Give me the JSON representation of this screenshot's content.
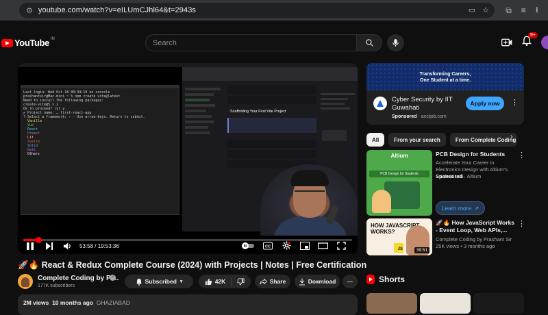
{
  "browser": {
    "url": "youtube.com/watch?v=eILUmCJhl64&t=2943s"
  },
  "header": {
    "logo_text": "YouTube",
    "country": "IN",
    "search_placeholder": "Search",
    "notification_count": "9+"
  },
  "player": {
    "time_current": "53:58",
    "time_total": "19:53:36",
    "time_display": "53:58 / 19:53:36",
    "progress_fraction": 0.045,
    "terminal": {
      "lines": [
        "Last login: Wed Oct 18 00:34:19 on console",
        "prashantsir@Mac-mini ~ % npm create vite@latest",
        "Need to install the following packages:",
        "create-vite@5.x.x",
        "Ok to proceed? (y) y",
        "✔ Project name: … first-react-app",
        "? Select a framework: › - Use arrow-keys. Return to submit."
      ],
      "options": [
        "Vanilla",
        "Vue",
        "React",
        "Preact",
        "Lit",
        "Svelte",
        "Solid",
        "Qwik",
        "Others"
      ]
    },
    "docs_heading": "Scaffolding Your First Vite Project"
  },
  "video": {
    "title": "🚀🔥 React & Redux Complete Course (2024) with Projects | Notes | Free Certification",
    "channel_name": "Complete Coding by Pr...",
    "subscribers": "177K subscribers",
    "subscribed_label": "Subscribed",
    "likes": "42K",
    "share_label": "Share",
    "download_label": "Download",
    "views": "2M views",
    "age": "10 months ago",
    "location": "GHAZIABAD"
  },
  "ad": {
    "banner_line1": "Transforming Careers,",
    "banner_line2": "One Student at a time.",
    "title": "Cyber Security by IIT Guwahati",
    "sponsored": "Sponsored",
    "domain": "accijob.com",
    "cta": "Apply now"
  },
  "chips": [
    "All",
    "From your search",
    "From Complete Coding"
  ],
  "recommendations": [
    {
      "title": "PCB Design for Students",
      "desc": "Accelerate Your Career in Electronics Design with Altium's Student Lab.",
      "sponsored": "Sponsored",
      "brand": "Altium",
      "cta": "Learn more",
      "thumb_brand": "Altium",
      "thumb_band": "PCB Design for Students"
    },
    {
      "title": "🚀🔥 How JavaScript Works - Event Loop, Web APIs,...",
      "channel": "Complete Coding by Prashant Sir",
      "meta": "25K views • 3 months ago",
      "duration": "39:51",
      "thumb_text": "HOW JAVASCRIPT WORKS?",
      "thumb_badge": "JS"
    }
  ],
  "shorts": {
    "label": "Shorts"
  },
  "colors": {
    "bg": "#0f0f0f",
    "accent_red": "#ff0000",
    "link_blue": "#3ea6ff"
  }
}
